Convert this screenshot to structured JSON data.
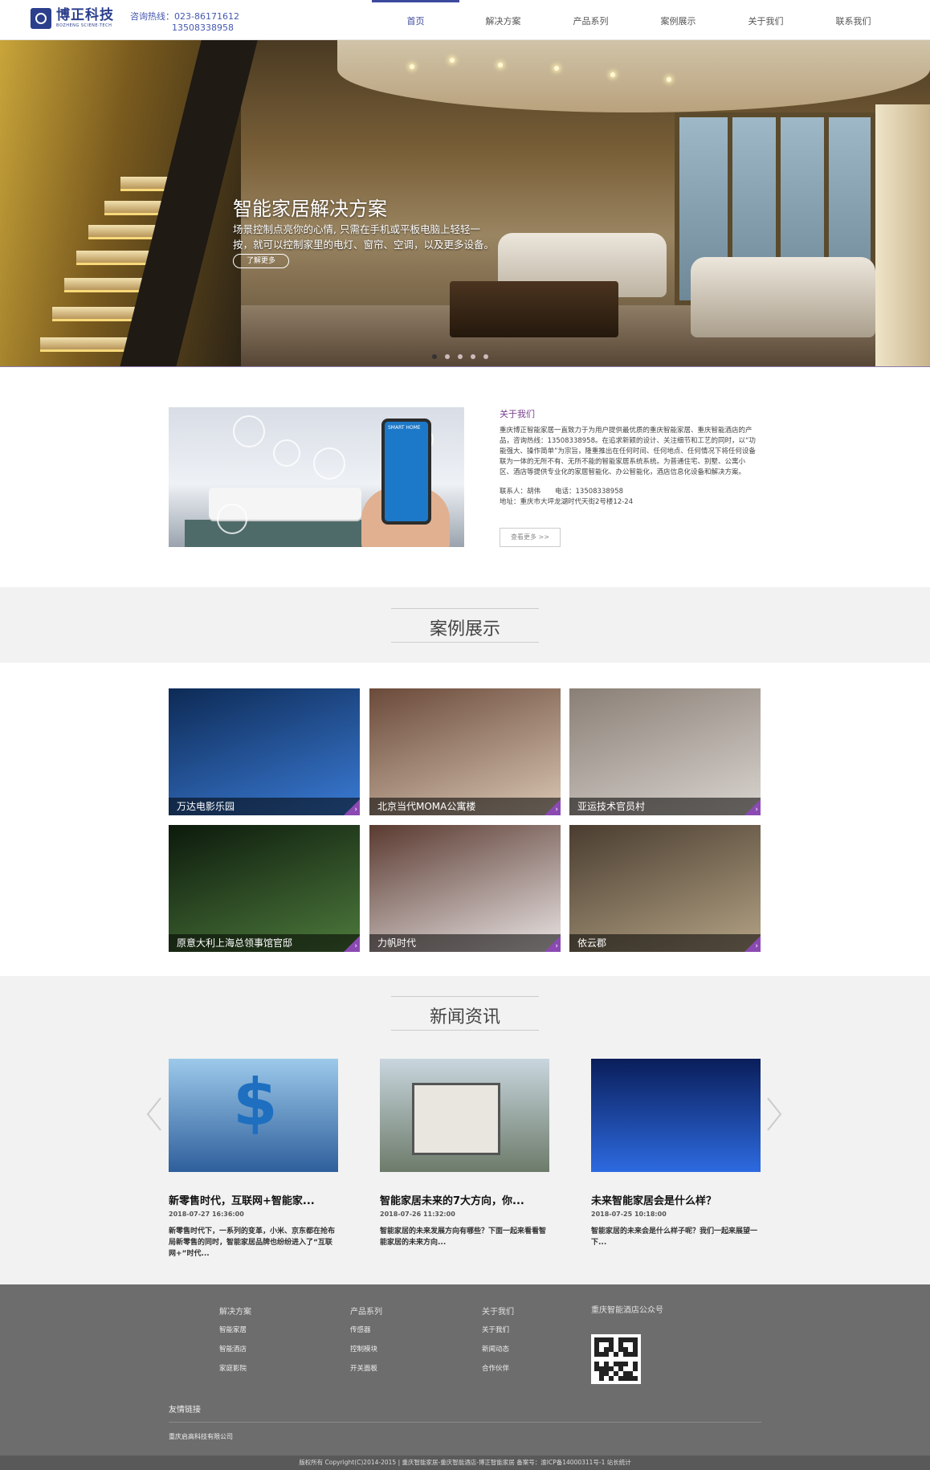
{
  "header": {
    "logo_cn": "博正科技",
    "logo_en": "BOZHENG SCIENE-TECH",
    "hotline_label": "咨询热线：023-86171612",
    "hotline_mobile": "13508338958",
    "nav": [
      "首页",
      "解决方案",
      "产品系列",
      "案例展示",
      "关于我们",
      "联系我们"
    ],
    "active_nav": "首页"
  },
  "banner": {
    "title": "智能家居解决方案",
    "desc": "场景控制点亮你的心情, 只需在手机或平板电脑上轻轻一按，就可以控制家里的电灯、窗帘、空调，以及更多设备。",
    "button": "了解更多",
    "slides_total": 5,
    "slide_active": 1
  },
  "about": {
    "image_phone_text": "SMART HOME",
    "title": "关于我们",
    "text": "重庆博正智能家居一直致力于为用户提供最优质的重庆智能家居、重庆智能酒店的产品，咨询热线：13508338958。在追求新颖的设计、关注细节和工艺的同时，以“功能强大、操作简单”为宗旨，隆重推出在任何时间、任何地点、任何情况下将任何设备联为一体的无所不有、无所不能的智能家居系统系统。为普通住宅、别墅、公寓小区、酒店等提供专业化的家居智能化、办公智能化，酒店信息化设备和解决方案。",
    "contact_label": "联系人：胡伟",
    "phone_label": "电话：13508338958",
    "address": "地址：重庆市大坪龙湖时代天街2号楼12-24",
    "more": "查看更多 >>"
  },
  "cases": {
    "title": "案例展示",
    "items": [
      {
        "label": "万达电影乐园",
        "c1": "#0d2a55",
        "c2": "#3a7bd5"
      },
      {
        "label": "北京当代MOMA公寓楼",
        "c1": "#6b4a3a",
        "c2": "#d8c6b2"
      },
      {
        "label": "亚运技术官员村",
        "c1": "#8a7f76",
        "c2": "#d9d4cf"
      },
      {
        "label": "原意大利上海总领事馆官邸",
        "c1": "#0c1a0c",
        "c2": "#4d7a3c"
      },
      {
        "label": "力帆时代",
        "c1": "#5a3a30",
        "c2": "#e9e4e4"
      },
      {
        "label": "依云郡",
        "c1": "#4a3d30",
        "c2": "#b3a284"
      }
    ]
  },
  "news": {
    "title": "新闻资讯",
    "items": [
      {
        "title": "新零售时代，互联网+智能家...",
        "date": "2018-07-27 16:36:00",
        "summary": "新零售时代下，一系列的变革，小米、京东都在抢布局新零售的同时，智能家居品牌也纷纷进入了“互联网+”时代...",
        "c1": "#9cc9ea",
        "c2": "#2f5f9c"
      },
      {
        "title": "智能家居未来的7大方向，你...",
        "date": "2018-07-26 11:32:00",
        "summary": "智能家居的未来发展方向有哪些？下面一起来看看智能家居的未来方向...",
        "c1": "#c9d6de",
        "c2": "#6c7b6a"
      },
      {
        "title": "未来智能家居会是什么样？",
        "date": "2018-07-25 10:18:00",
        "summary": "智能家居的未来会是什么样子呢？我们一起来展望一下...",
        "c1": "#0a1e5a",
        "c2": "#2d6ae0"
      }
    ]
  },
  "footer": {
    "cols": [
      {
        "heading": "解决方案",
        "items": [
          "智能家居",
          "智能酒店",
          "家庭影院"
        ]
      },
      {
        "heading": "产品系列",
        "items": [
          "传感器",
          "控制模块",
          "开关面板"
        ]
      },
      {
        "heading": "关于我们",
        "items": [
          "关于我们",
          "新闻动态",
          "合作伙伴"
        ]
      }
    ],
    "wechat": "重庆智能酒店公众号",
    "links_title": "友情链接",
    "link": "重庆启高科技有限公司",
    "copyright": "版权所有 Copyright(C)2014-2015 | 重庆智能家居-重庆智能酒店-博正智能家居 备案号：渝ICP备14000311号-1  站长统计"
  },
  "colors": {
    "brand": "#2b3f8c",
    "accent_purple": "#8b4ab2",
    "footer_bg": "#6d6d6d",
    "section_bg": "#f2f2f2"
  }
}
